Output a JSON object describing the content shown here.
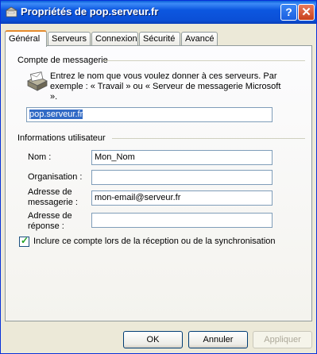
{
  "window": {
    "title": "Propriétés de pop.serveur.fr",
    "help_glyph": "?",
    "close_glyph": "✕"
  },
  "tabs": [
    {
      "label": "Général"
    },
    {
      "label": "Serveurs"
    },
    {
      "label": "Connexion"
    },
    {
      "label": "Sécurité"
    },
    {
      "label": "Avancé"
    }
  ],
  "account_group": {
    "title": "Compte de messagerie",
    "description": "Entrez le nom que vous voulez donner à ces serveurs. Par exemple : « Travail » ou « Serveur de messagerie Microsoft ».",
    "account_name": "pop.serveur.fr"
  },
  "user_group": {
    "title": "Informations utilisateur",
    "name_label": "Nom :",
    "name_value": "Mon_Nom",
    "org_label": "Organisation :",
    "org_value": "",
    "email_label_1": "Adresse de",
    "email_label_2": "messagerie :",
    "email_value": "mon-email@serveur.fr",
    "reply_label_1": "Adresse de",
    "reply_label_2": "réponse :",
    "reply_value": ""
  },
  "include_checkbox": {
    "label": "Inclure ce compte lors de la réception ou de la synchronisation",
    "checked": true
  },
  "buttons": {
    "ok": "OK",
    "cancel": "Annuler",
    "apply": "Appliquer"
  }
}
